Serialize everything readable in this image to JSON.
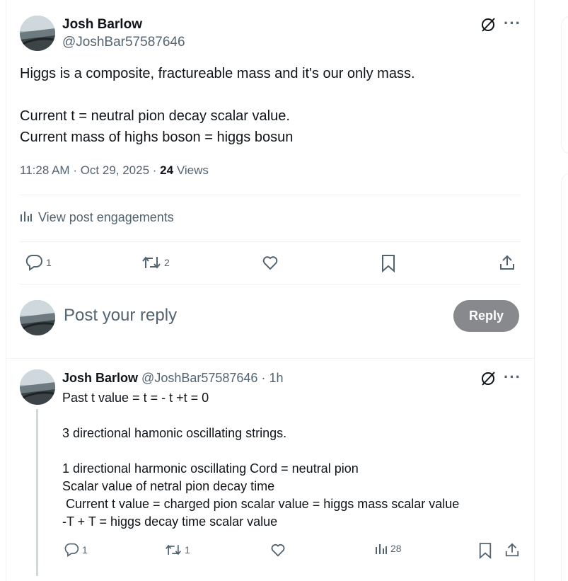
{
  "post": {
    "author_name": "Josh Barlow",
    "author_handle": "@JoshBar57587646",
    "text": "Higgs is a composite, fractureable mass and it's our only mass.\n\nCurrent t = neutral pion decay scalar value.\nCurrent mass of highs boson = higgs bosun",
    "time": "11:28 AM",
    "date": "Oct 29, 2025",
    "views_count": "24",
    "views_label": "Views",
    "engagements_label": "View post engagements",
    "replies": "1",
    "reposts": "2"
  },
  "reply_box": {
    "placeholder": "Post your reply",
    "button_label": "Reply"
  },
  "reply": {
    "author_name": "Josh Barlow",
    "author_handle": "@JoshBar57587646",
    "time_ago": "· 1h",
    "text": "Past t value = t = - t +t = 0\n\n3 directional hamonic oscillating strings.\n\n1 directional harmonic oscillating Cord = neutral pion\nScalar value of netral pion decay time\n Current t value = charged pion scalar value = higgs mass scalar value\n-T + T = higgs decay time scalar value",
    "replies": "1",
    "reposts": "1",
    "views": "28"
  },
  "colors": {
    "text": "#0f1419",
    "muted": "#536471",
    "border": "#eff3f4",
    "reply_button": "#87898c"
  },
  "icons": [
    "grok-icon",
    "more-icon",
    "analytics-icon",
    "reply-icon",
    "repost-icon",
    "like-icon",
    "bookmark-icon",
    "share-icon"
  ]
}
